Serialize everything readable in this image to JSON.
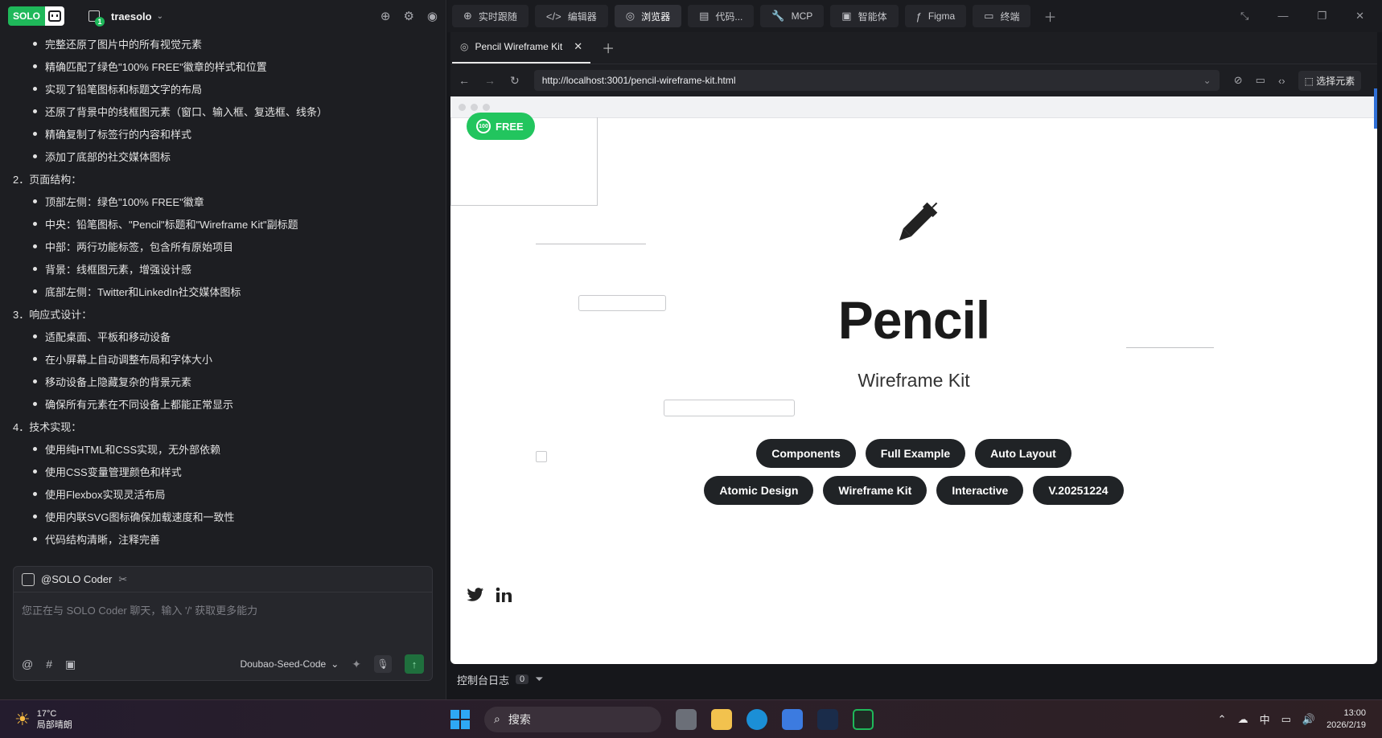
{
  "left_panel": {
    "badge": "SOLO",
    "workspace": "traesolo",
    "workspace_count": "1",
    "chat_lines": [
      {
        "kind": "bullet",
        "text": "完整还原了图片中的所有视觉元素"
      },
      {
        "kind": "bullet",
        "text": "精确匹配了绿色\"100% FREE\"徽章的样式和位置"
      },
      {
        "kind": "bullet",
        "text": "实现了铅笔图标和标题文字的布局"
      },
      {
        "kind": "bullet",
        "text": "还原了背景中的线框图元素（窗口、输入框、复选框、线条）"
      },
      {
        "kind": "bullet",
        "text": "精确复制了标签行的内容和样式"
      },
      {
        "kind": "bullet",
        "text": "添加了底部的社交媒体图标"
      },
      {
        "kind": "num",
        "text": "2．页面结构："
      },
      {
        "kind": "bullet",
        "text": "顶部左侧：绿色\"100% FREE\"徽章"
      },
      {
        "kind": "bullet",
        "text": "中央：铅笔图标、\"Pencil\"标题和\"Wireframe Kit\"副标题"
      },
      {
        "kind": "bullet",
        "text": "中部：两行功能标签，包含所有原始项目"
      },
      {
        "kind": "bullet",
        "text": "背景：线框图元素，增强设计感"
      },
      {
        "kind": "bullet",
        "text": "底部左侧：Twitter和LinkedIn社交媒体图标"
      },
      {
        "kind": "num",
        "text": "3．响应式设计："
      },
      {
        "kind": "bullet",
        "text": "适配桌面、平板和移动设备"
      },
      {
        "kind": "bullet",
        "text": "在小屏幕上自动调整布局和字体大小"
      },
      {
        "kind": "bullet",
        "text": "移动设备上隐藏复杂的背景元素"
      },
      {
        "kind": "bullet",
        "text": "确保所有元素在不同设备上都能正常显示"
      },
      {
        "kind": "num",
        "text": "4．技术实现："
      },
      {
        "kind": "bullet",
        "text": "使用纯HTML和CSS实现，无外部依赖"
      },
      {
        "kind": "bullet",
        "text": "使用CSS变量管理颜色和样式"
      },
      {
        "kind": "bullet",
        "text": "使用Flexbox实现灵活布局"
      },
      {
        "kind": "bullet",
        "text": "使用内联SVG图标确保加载速度和一致性"
      },
      {
        "kind": "bullet",
        "text": "代码结构清晰，注释完善"
      }
    ],
    "composer": {
      "agent": "@SOLO Coder",
      "placeholder": "您正在与 SOLO Coder 聊天，输入 '/' 获取更多能力",
      "model": "Doubao-Seed-Code"
    }
  },
  "top_tabs": [
    {
      "icon": "target-icon",
      "label": "实时跟随",
      "active": false
    },
    {
      "icon": "code-icon",
      "label": "编辑器",
      "active": false
    },
    {
      "icon": "compass-icon",
      "label": "浏览器",
      "active": true
    },
    {
      "icon": "doc-icon",
      "label": "代码...",
      "active": false
    },
    {
      "icon": "wrench-icon",
      "label": "MCP",
      "active": false
    },
    {
      "icon": "bot-icon",
      "label": "智能体",
      "active": false
    },
    {
      "icon": "figma-icon",
      "label": "Figma",
      "active": false
    },
    {
      "icon": "terminal-icon",
      "label": "终端",
      "active": false
    }
  ],
  "browser": {
    "tab_title": "Pencil Wireframe Kit",
    "url": "http://localhost:3001/pencil-wireframe-kit.html",
    "pick_element": "选择元素"
  },
  "page": {
    "badge_circle": "100",
    "badge_text": "FREE",
    "title": "Pencil",
    "subtitle": "Wireframe Kit",
    "tags_row1": [
      "Components",
      "Full Example",
      "Auto Layout"
    ],
    "tags_row2": [
      "Atomic Design",
      "Wireframe Kit",
      "Interactive",
      "V.20251224"
    ]
  },
  "console": {
    "label": "控制台日志",
    "count": "0"
  },
  "taskbar": {
    "temp": "17°C",
    "weather": "局部晴朗",
    "search": "搜索",
    "ime": "中",
    "time": "13:00",
    "date": "2026/2/19"
  },
  "colors": {
    "accent_green": "#22c55e",
    "tag_bg": "#202326",
    "panel_bg": "#1d1e22"
  }
}
